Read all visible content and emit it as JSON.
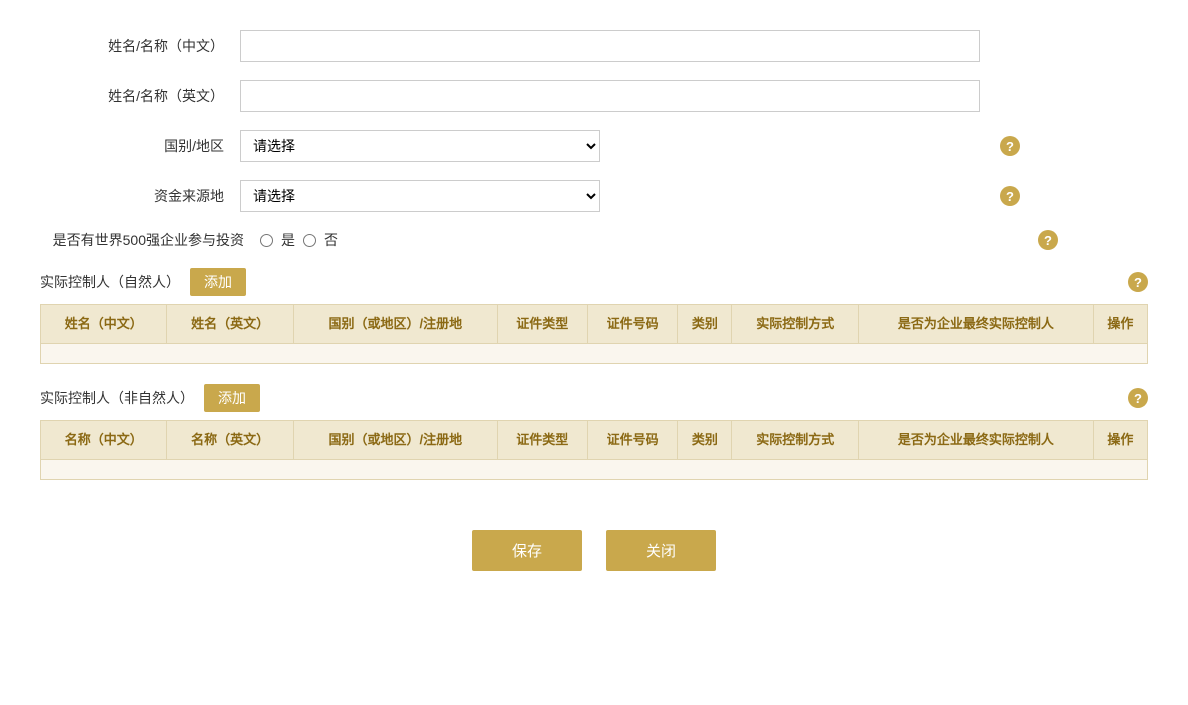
{
  "form": {
    "name_cn_label": "姓名/名称（中文）",
    "name_en_label": "姓名/名称（英文）",
    "country_label": "国别/地区",
    "fund_source_label": "资金来源地",
    "fortune500_label": "是否有世界500强企业参与投资",
    "select_placeholder": "请选择",
    "yes_label": "是",
    "no_label": "否",
    "help_text": "?"
  },
  "section1": {
    "title": "实际控制人（自然人）",
    "add_label": "添加",
    "columns": [
      "姓名（中文）",
      "姓名（英文）",
      "国别（或地区）/注册地",
      "证件类型",
      "证件号码",
      "类别",
      "实际控制方式",
      "是否为企业最终实际控制人",
      "操作"
    ]
  },
  "section2": {
    "title": "实际控制人（非自然人）",
    "add_label": "添加",
    "columns": [
      "名称（中文）",
      "名称（英文）",
      "国别（或地区）/注册地",
      "证件类型",
      "证件号码",
      "类别",
      "实际控制方式",
      "是否为企业最终实际控制人",
      "操作"
    ]
  },
  "buttons": {
    "save": "保存",
    "close": "关闭"
  }
}
